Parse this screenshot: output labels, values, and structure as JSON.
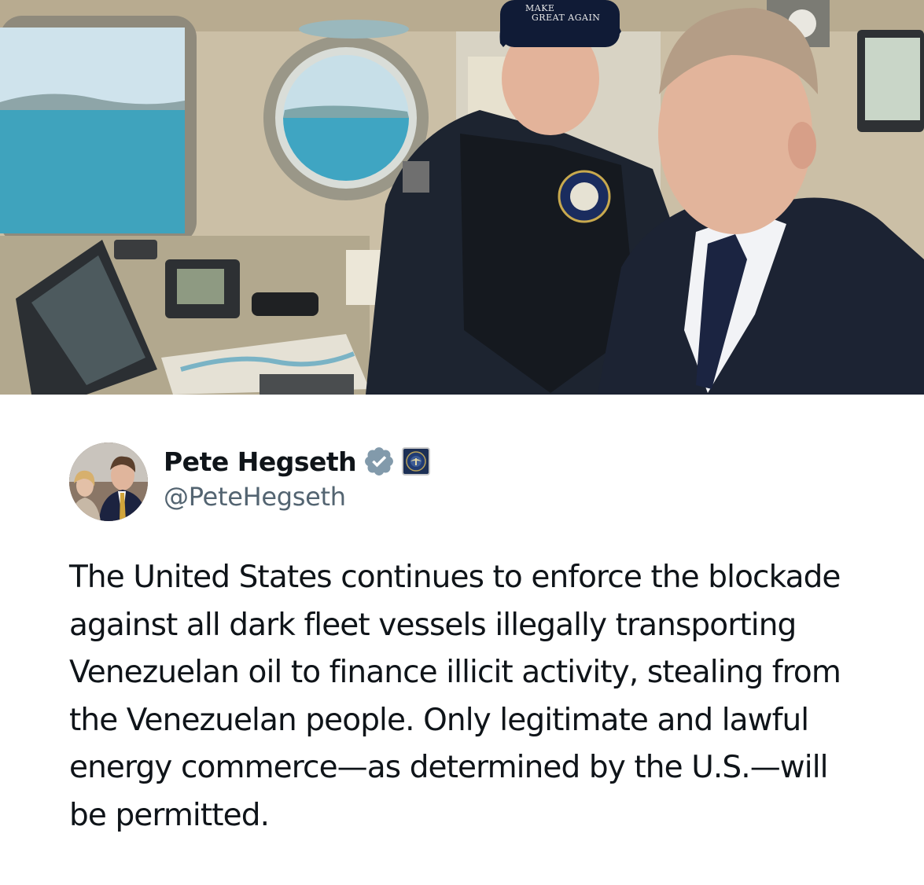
{
  "photo": {
    "hat_line_1": "MAKE",
    "hat_line_2": "GREAT AGAIN"
  },
  "author": {
    "display_name": "Pete Hegseth",
    "handle": "@PeteHegseth",
    "verified_badge": "verified-badge-icon",
    "affiliation_badge": "department-seal-icon"
  },
  "tweet": {
    "lines": [
      "The United States continues to enforce the blockade",
      "against all dark fleet vessels illegally transporting",
      "Venezuelan oil to finance illicit activity, stealing from",
      "the Venezuelan people. Only legitimate and lawful",
      "energy commerce—as determined by the U.S.—will",
      "be permitted."
    ]
  },
  "colors": {
    "verified_blue": "#829aab",
    "handle_gray": "#536471",
    "text": "#0f1419"
  }
}
